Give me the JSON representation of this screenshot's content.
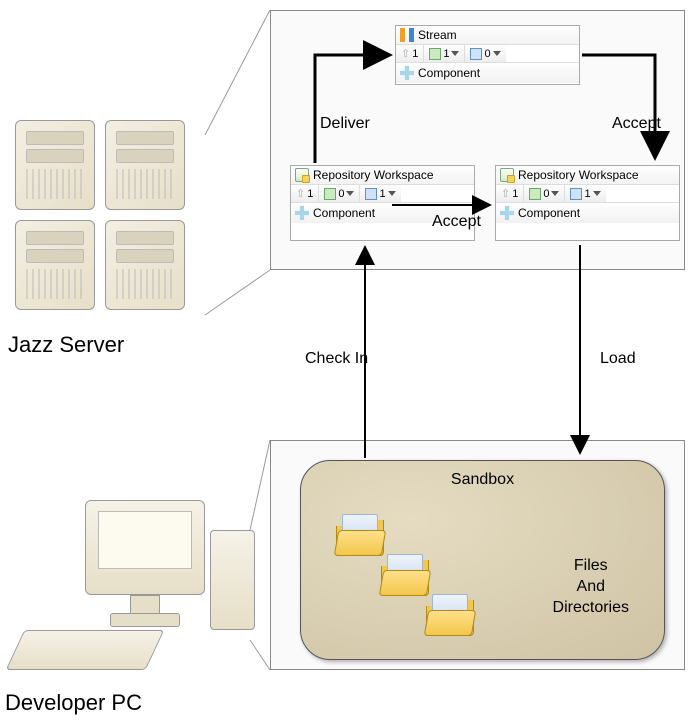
{
  "labels": {
    "jazzServer": "Jazz Server",
    "developerPc": "Developer PC",
    "deliver": "Deliver",
    "acceptTop": "Accept",
    "acceptMid": "Accept",
    "checkIn": "Check In",
    "load": "Load"
  },
  "stream": {
    "title": "Stream",
    "status": [
      {
        "icon": "up",
        "value": "1"
      },
      {
        "icon": "box-green",
        "value": "1",
        "dropdown": true
      },
      {
        "icon": "box-blue",
        "value": "0",
        "dropdown": true
      }
    ],
    "component": "Component"
  },
  "repoLeft": {
    "title": "Repository Workspace",
    "status": [
      {
        "icon": "up",
        "value": "1"
      },
      {
        "icon": "box-green",
        "value": "0",
        "dropdown": true
      },
      {
        "icon": "box-blue",
        "value": "1",
        "dropdown": true
      }
    ],
    "component": "Component"
  },
  "repoRight": {
    "title": "Repository Workspace",
    "status": [
      {
        "icon": "up",
        "value": "1"
      },
      {
        "icon": "box-green",
        "value": "0",
        "dropdown": true
      },
      {
        "icon": "box-blue",
        "value": "1",
        "dropdown": true
      }
    ],
    "component": "Component"
  },
  "sandbox": {
    "title": "Sandbox",
    "body": "Files\nAnd\nDirectories"
  }
}
